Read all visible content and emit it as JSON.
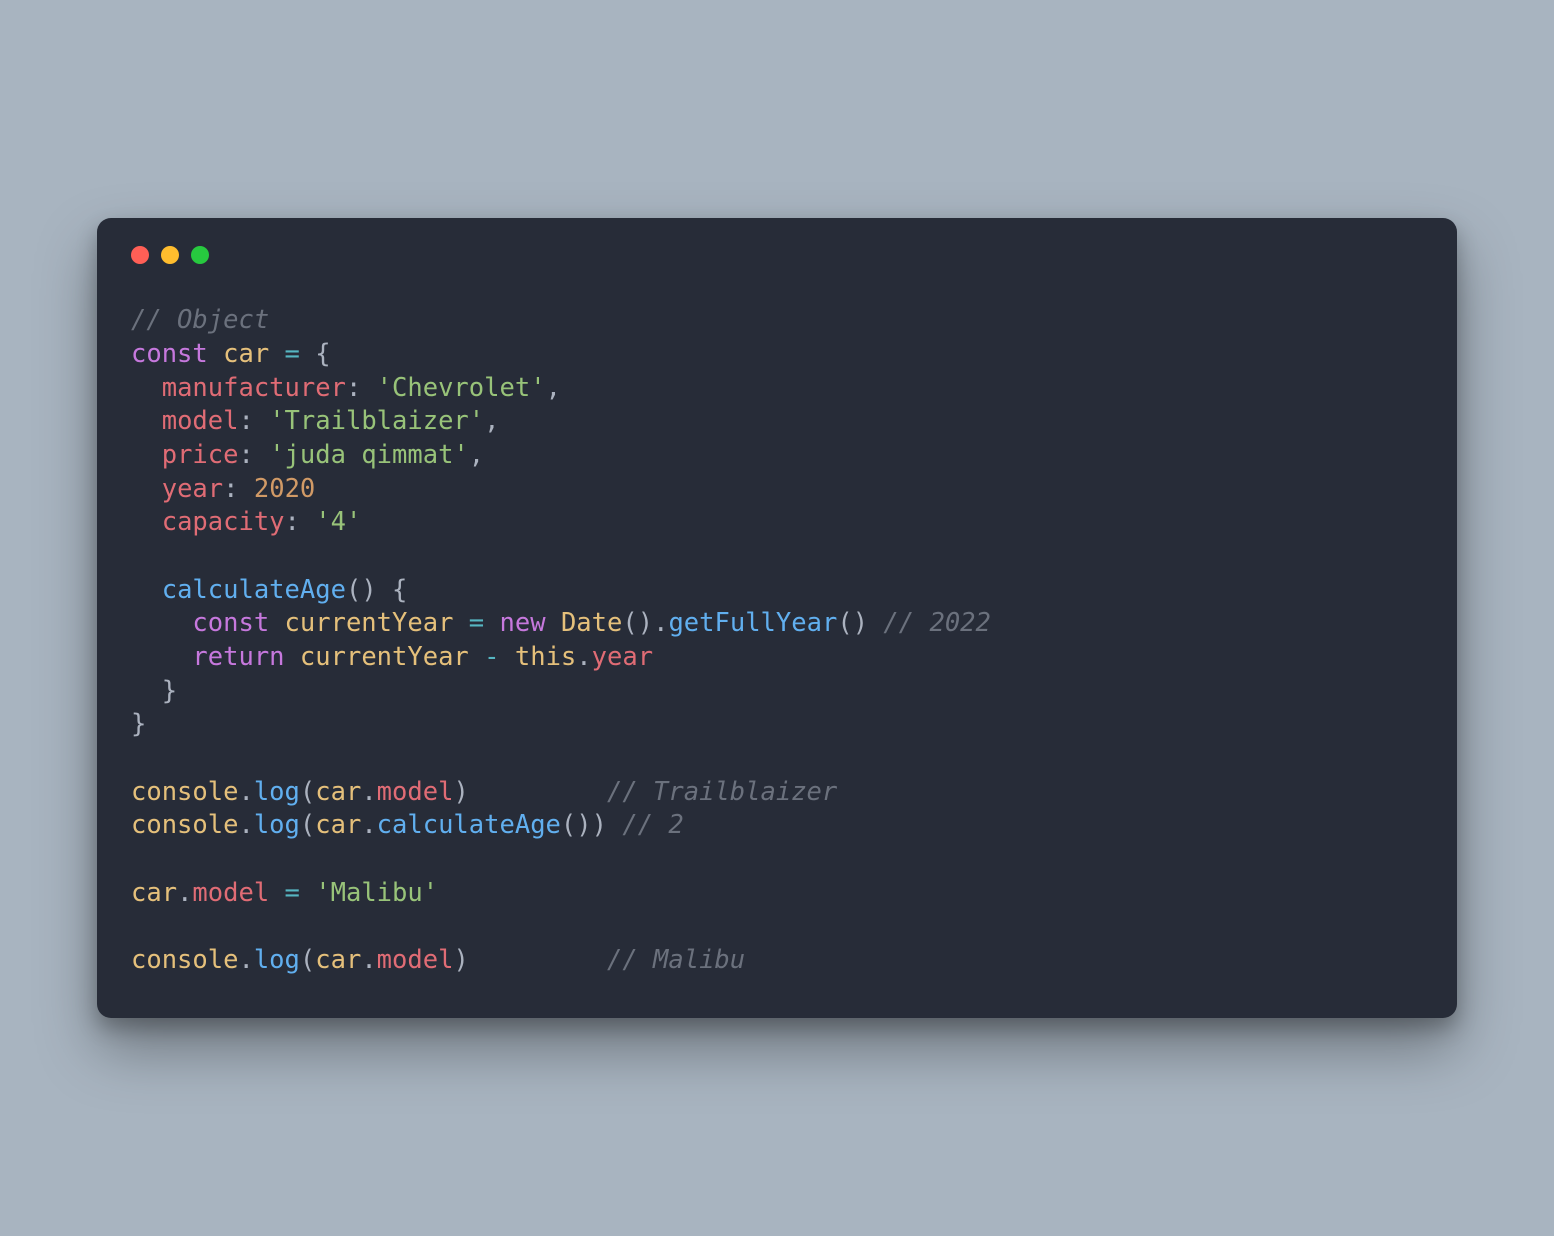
{
  "colors": {
    "background": "#a8b4c0",
    "window": "#272c38",
    "traffic_red": "#ff5f56",
    "traffic_yellow": "#ffbd2e",
    "traffic_green": "#27c93f",
    "comment": "#6b717d",
    "keyword": "#c678dd",
    "variable": "#e5c07b",
    "equals": "#56b6c2",
    "punctuation": "#abb2bf",
    "property": "#e06c75",
    "string": "#98c379",
    "number": "#d19a66",
    "function": "#61afef"
  },
  "code": {
    "cm_object": "// Object",
    "kw_const_1": "const",
    "var_car": "car",
    "eq": "=",
    "brace_open": "{",
    "prop_manufacturer": "manufacturer",
    "str_chevrolet": "'Chevrolet'",
    "prop_model": "model",
    "str_trailblaizer": "'Trailblaizer'",
    "prop_price": "price",
    "str_price": "'juda qimmat'",
    "prop_year": "year",
    "num_year": "2020",
    "prop_capacity": "capacity",
    "str_capacity": "'4'",
    "fn_calculateAge": "calculateAge",
    "paren_open": "(",
    "paren_close": ")",
    "kw_const_2": "const",
    "var_currentYear": "currentYear",
    "kw_new": "new",
    "class_Date": "Date",
    "fn_getFullYear": "getFullYear",
    "cm_2022": "// 2022",
    "kw_return": "return",
    "op_minus": "-",
    "kw_this": "this",
    "prop_year_ref": "year",
    "brace_close": "}",
    "obj_console_1": "console",
    "fn_log_1": "log",
    "prop_model_ref_1": "model",
    "cm_trailblaizer": "// Trailblaizer",
    "obj_console_2": "console",
    "fn_log_2": "log",
    "fn_calculateAge_call": "calculateAge",
    "cm_2": "// 2",
    "prop_model_assign": "model",
    "str_malibu": "'Malibu'",
    "obj_console_3": "console",
    "fn_log_3": "log",
    "prop_model_ref_2": "model",
    "cm_malibu": "// Malibu",
    "colon": ":",
    "comma": ",",
    "dot": "."
  }
}
